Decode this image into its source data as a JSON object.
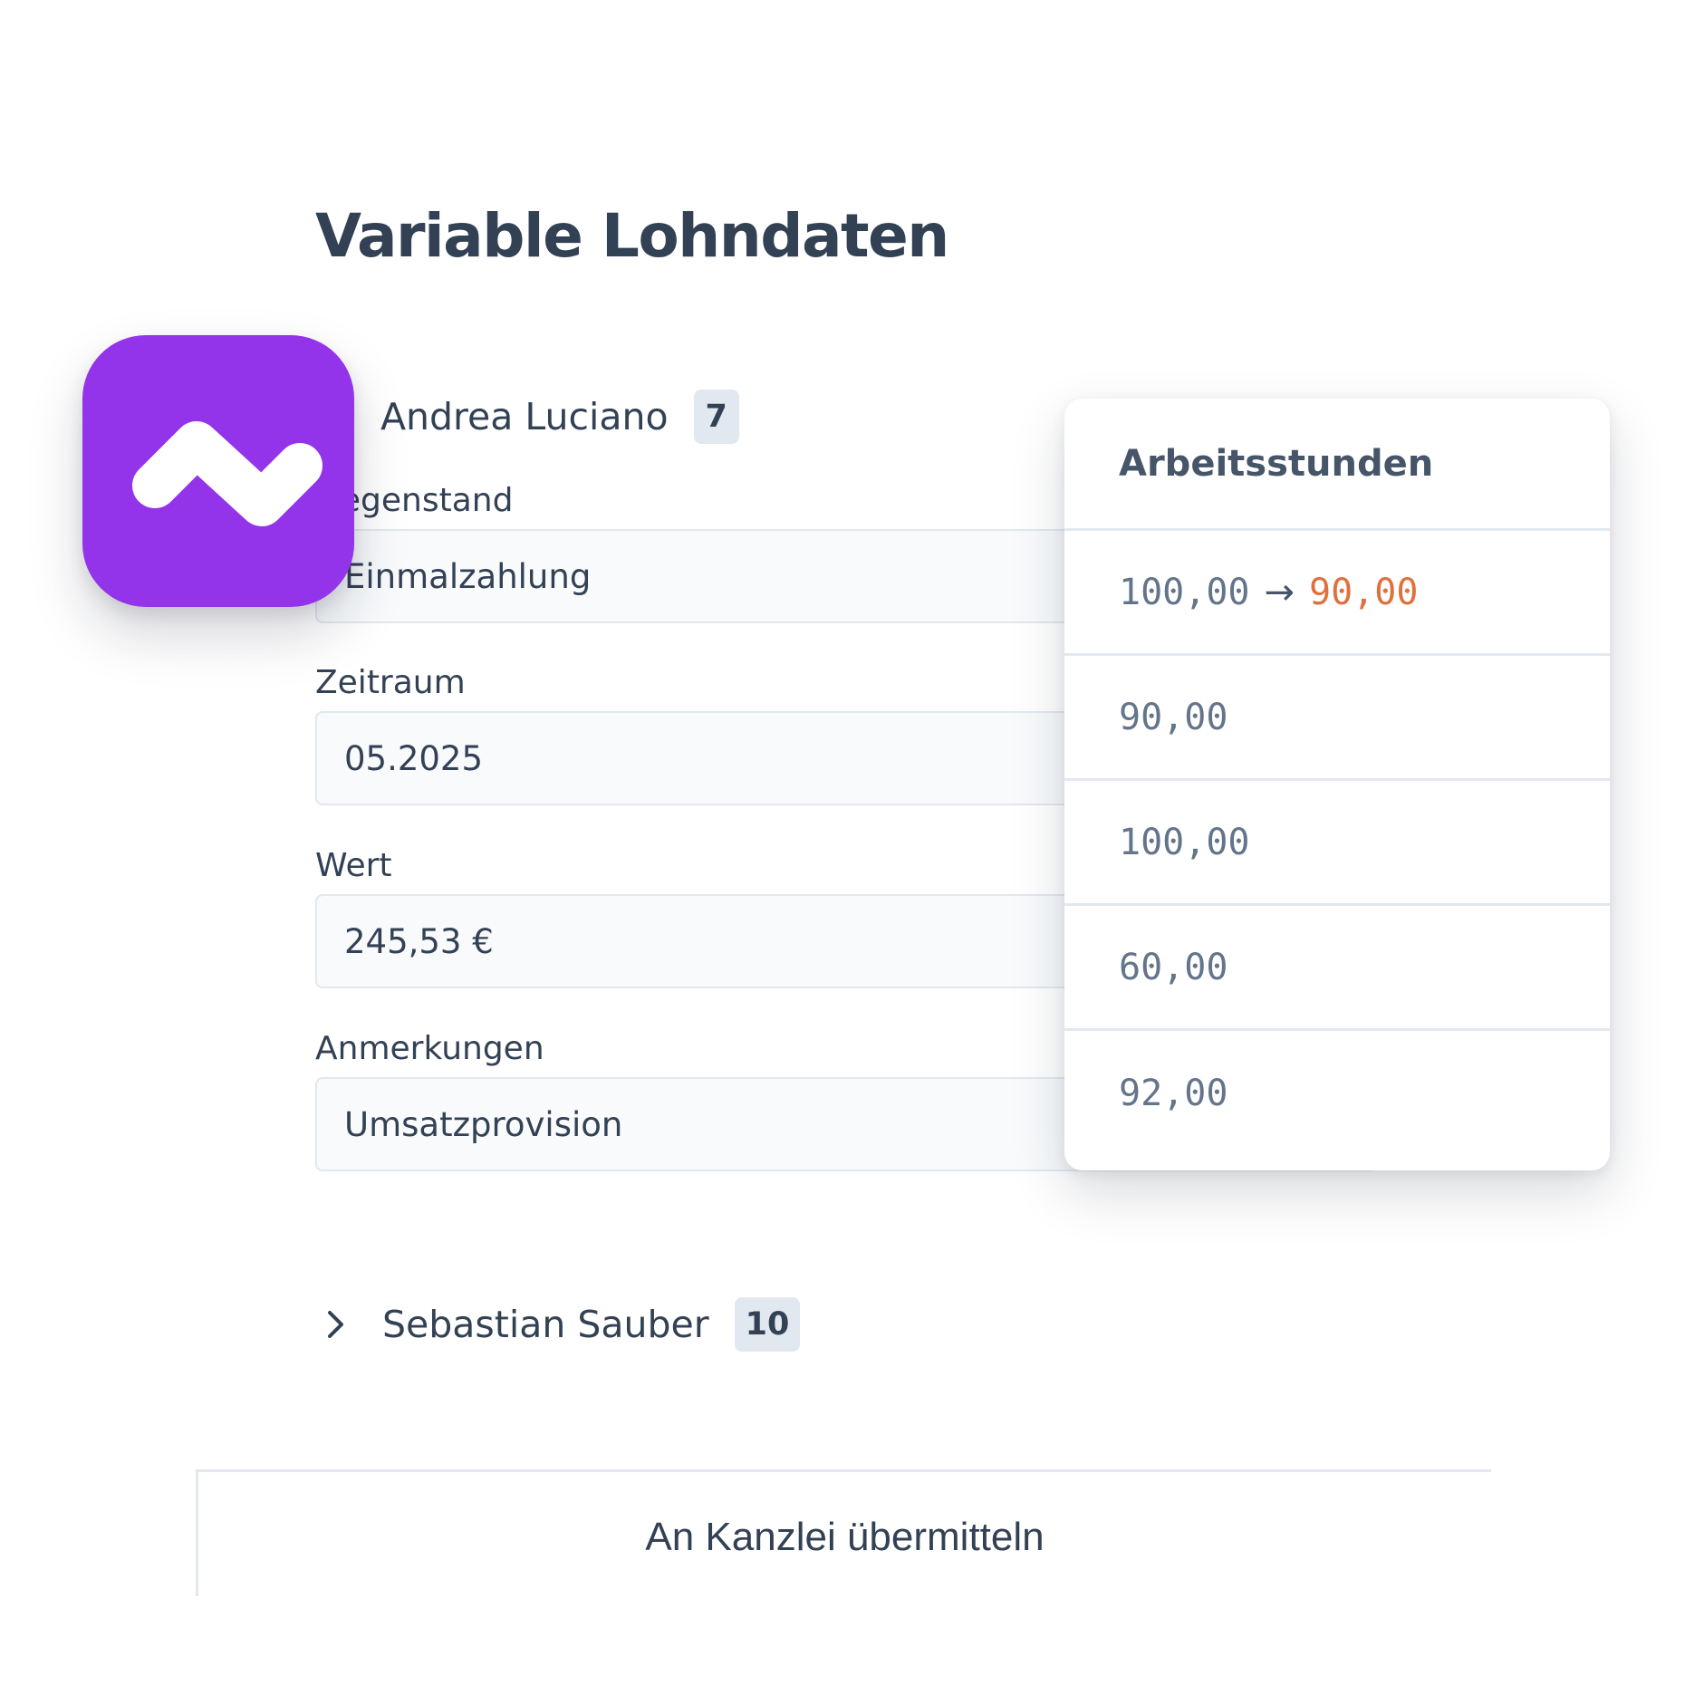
{
  "page": {
    "title": "Variable Lohndaten"
  },
  "app_icon": {
    "name": "app-logo-icon",
    "color": "#9333ea"
  },
  "employees": [
    {
      "name": "Andrea Luciano",
      "count": "7"
    },
    {
      "name": "Sebastian Sauber",
      "count": "10"
    }
  ],
  "form": {
    "fields": [
      {
        "label": "Gegenstand",
        "value": "Einmalzahlung"
      },
      {
        "label": "Zeitraum",
        "value": "05.2025"
      },
      {
        "label": "Wert",
        "value": "245,53 €"
      },
      {
        "label": "Anmerkungen",
        "value": "Umsatzprovision"
      }
    ]
  },
  "popover": {
    "title": "Arbeitsstunden",
    "change": {
      "old": "100,00",
      "arrow": "→",
      "new": "90,00",
      "new_color": "#e0703d"
    },
    "values": [
      "90,00",
      "100,00",
      "60,00",
      "92,00"
    ]
  },
  "actions": {
    "submit_label": "An Kanzlei übermitteln"
  }
}
